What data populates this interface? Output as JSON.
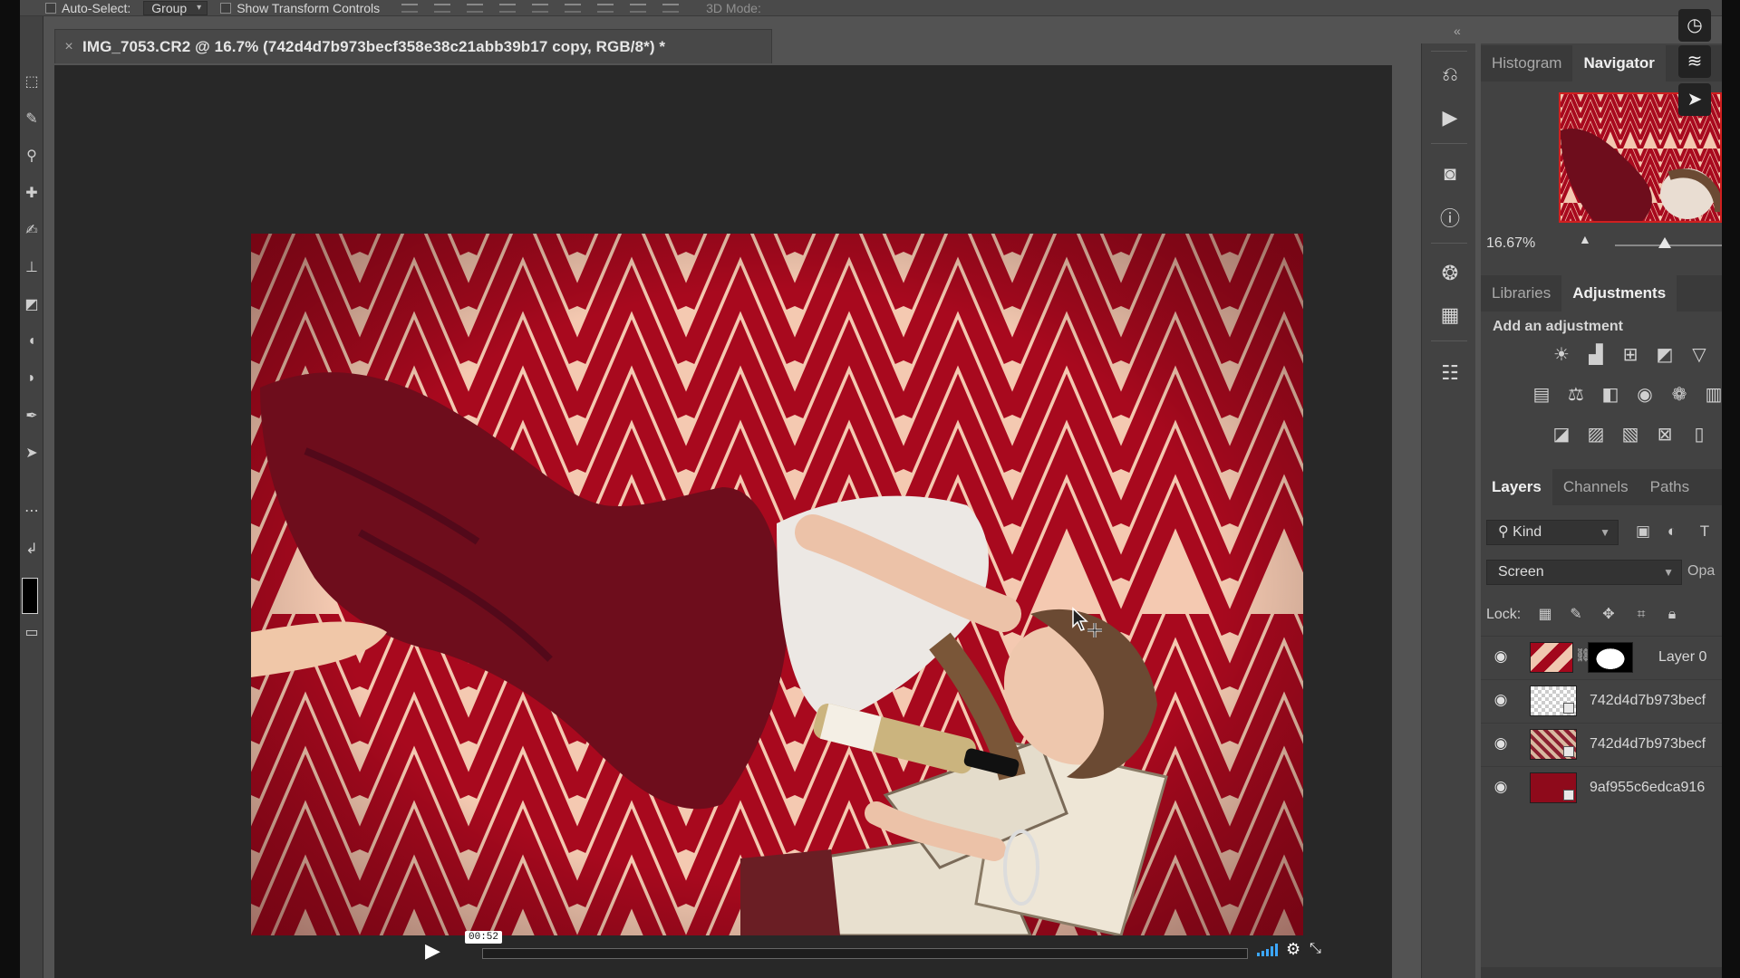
{
  "options_bar": {
    "auto_select_label": "Auto-Select:",
    "auto_select_value": "Group",
    "transform_controls_label": "Show Transform Controls",
    "mode_3d_label": "3D Mode:"
  },
  "document": {
    "tab_title": "IMG_7053.CR2 @ 16.7% (742d4d7b973becf358e38c21abb39b17 copy, RGB/8*) *",
    "close_glyph": "×"
  },
  "player": {
    "timestamp": "00:52",
    "progress": 0.0,
    "accent": "#3ca7ff"
  },
  "panels": {
    "top_tabs": [
      "Histogram",
      "Navigator"
    ],
    "top_active": "Navigator",
    "zoom_value": "16.67%",
    "zoom_slider_level": 0.39,
    "mid_tabs": [
      "Libraries",
      "Adjustments"
    ],
    "mid_active": "Adjustments",
    "adjustments_heading": "Add an adjustment",
    "layer_tabs": [
      "Layers",
      "Channels",
      "Paths"
    ],
    "layer_active": "Layers",
    "kind_filter": "Kind",
    "blend_mode": "Screen",
    "opacity_label": "Opa",
    "lock_label": "Lock:",
    "layers": [
      {
        "name": "Layer 0",
        "visible": true
      },
      {
        "name": "742d4d7b973becf",
        "visible": true
      },
      {
        "name": "742d4d7b973becf",
        "visible": true
      },
      {
        "name": "9af955c6edca916",
        "visible": true
      }
    ]
  },
  "colors": {
    "app_bg": "#535353",
    "panel_bg": "#424242",
    "canvas_bg": "#282828",
    "pattern_red": "#a3081c",
    "pattern_cream": "#f6d2bd",
    "blanket": "#6e0d1c"
  }
}
